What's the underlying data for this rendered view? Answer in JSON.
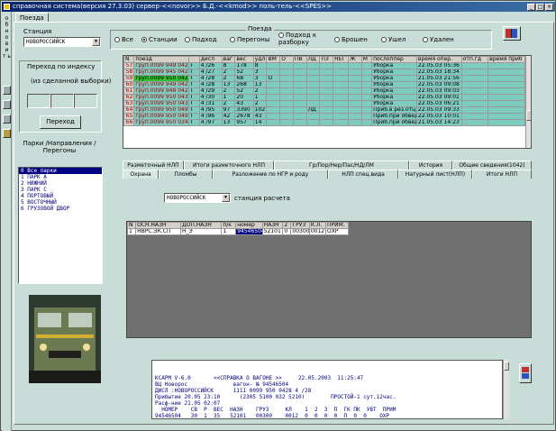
{
  "window": {
    "title": "справочная система(версия 27.3.03) сервер-<<novor>> Б.Д.-<<kmod>> поль-тель-<<SPES>>"
  },
  "left_strip": {
    "text": "о б н о в и т ь"
  },
  "top_tab": {
    "label": "Поезда"
  },
  "station": {
    "label": "Станция",
    "value": "НОВОРОССИЙСК"
  },
  "trains_group": {
    "title": "Поезда",
    "radios": [
      {
        "label": "Все",
        "selected": false
      },
      {
        "label": "Станции",
        "selected": true
      },
      {
        "label": "Подход",
        "selected": false
      },
      {
        "label": "Перегоны",
        "selected": false
      },
      {
        "label": "Подход к разборку",
        "selected": false
      },
      {
        "label": "Брошен",
        "selected": false
      },
      {
        "label": "Ушел",
        "selected": false
      },
      {
        "label": "Удален",
        "selected": false
      }
    ]
  },
  "index_search": {
    "label1": "Переход по индексу",
    "label2": "(из сделанной выборки)",
    "button": "Переход"
  },
  "parks": {
    "label": "Парки /Направления / Перегоны",
    "items": [
      "0 Все парки",
      "1 ПАРК А",
      "2 НИЖНИЙ",
      "3 ПАРК С",
      "4 ПОРТОВЫЙ",
      "5 ВОСТОЧНЫЙ",
      "6 ГРУЗОВОЙ ДВОР"
    ]
  },
  "trains_table": {
    "headers": [
      "N",
      "поезд",
      "",
      "дисл",
      "ваг",
      "вес",
      "удл",
      "ВМ",
      "О",
      "ПВ",
      "ЛД",
      "ПЗ",
      "НЕГ",
      "Ж",
      "М",
      "послоппер",
      "время опер.",
      "отп.гд",
      "время приб"
    ],
    "rows": [
      [
        "57",
        "груп.0099 949 0426",
        "Г",
        "4 /26",
        "8",
        "178",
        "8",
        "",
        "",
        "",
        "",
        "",
        "",
        "",
        "",
        "Уборка",
        "22.05.03 05:36",
        "",
        ""
      ],
      [
        "58",
        "груп.0099 945 0427",
        "Г",
        "4 /27",
        "2",
        "52",
        "3",
        "",
        "",
        "",
        "",
        "",
        "",
        "",
        "",
        "Уборка",
        "22.05.03 18:34",
        "",
        ""
      ],
      [
        "59",
        "груп.0099 950 0428",
        "Г",
        "4 /28",
        "2",
        "68",
        "3",
        "О",
        "",
        "",
        "",
        "",
        "",
        "",
        "",
        "Уборка",
        "21.05.03 21:56",
        "",
        ""
      ],
      [
        "60",
        "груп.0099 949 0429",
        "Г",
        "4 /28",
        "13",
        "268",
        "13",
        "",
        "",
        "",
        "",
        "",
        "",
        "",
        "",
        "Уборка",
        "22.05.03 09:08",
        "",
        ""
      ],
      [
        "61",
        "груп.0099 948 0429",
        "Г",
        "4 /29",
        "2",
        "52",
        "2",
        "",
        "",
        "",
        "",
        "",
        "",
        "",
        "",
        "Уборка",
        "22.05.03 09:03",
        "",
        ""
      ],
      [
        "62",
        "груп.0099 950 0430",
        "Г",
        "4 /30",
        "1",
        "20",
        "1",
        "",
        "",
        "",
        "",
        "",
        "",
        "",
        "",
        "Уборка",
        "22.05.03 09:01",
        "",
        ""
      ],
      [
        "63",
        "груп.0099 950 0431",
        "Г",
        "4 /31",
        "2",
        "43",
        "2",
        "",
        "",
        "",
        "",
        "",
        "",
        "",
        "",
        "Уборка",
        "22.05.03 06:21",
        "",
        ""
      ],
      [
        "64",
        "груп.0099 950 0495",
        "Г",
        "4 /95",
        "97",
        "3390",
        "102",
        "",
        "",
        "",
        "ЛД",
        "",
        "",
        "",
        "",
        "Приб.в рез.отц.",
        "22.05.03 09:33",
        "",
        ""
      ],
      [
        "65",
        "груп.0099 950 0496",
        "Г",
        "4 /96",
        "42",
        "2678",
        "43",
        "",
        "",
        "",
        "",
        "",
        "",
        "",
        "",
        "Приб.при обвед.",
        "22.05.03 10:01",
        "",
        ""
      ],
      [
        "66",
        "груп.0099 950 0344",
        "Г",
        "4 /97",
        "13",
        "957",
        "14",
        "",
        "",
        "",
        "",
        "",
        "",
        "",
        "",
        "Приб.при обвед.",
        "21.05.03 14:23",
        "",
        ""
      ]
    ],
    "selected_row": 2
  },
  "tabs_row1": [
    "Разметочный НЛП",
    "Итоги разметочного НЛП",
    "Гр/Пор/Нер/Пас/НД/ЛМ",
    "История",
    "Общие сведения(1042)"
  ],
  "tabs_row2": [
    "Охрана",
    "Пломбы",
    "Разложение по НГР и роду",
    "НЛП спец.вида",
    "Натурный лист(НЛП)",
    "Итоги НЛП"
  ],
  "calc_station": {
    "value": "НОВОРОССИЙСК",
    "label": "станция расчета"
  },
  "guard_table": {
    "headers": [
      "N",
      "ОСН.НАЗН",
      "ДОП.НАЗН",
      "п/к",
      "номер",
      "НАЗН",
      "2",
      "ГРУЗ",
      "К.Л.",
      "ПРИМ."
    ],
    "rows": [
      [
        "1",
        "НВРС.ЭК.СП",
        "Н_Э",
        "1",
        "94546504",
        "52101",
        "0",
        "00300",
        "0012",
        "ОХР"
      ]
    ]
  },
  "text_pane": {
    "lines": [
      "КСАРМ V-6.0       <<СПРАВКА О ВАГОНЕ >>     22.05.2003  11:25:47",
      "ВЦ Новорос              вагон- № 94546504",
      "ДИСЛ :НОВОРОССИЙСК      1111 0099 950 0428 4 /28",
      "Прибытие 20.05 23:10      (2305 5100 032 5210)        ПРОСТОЙ-1 сут.12час.",
      "Расф-ние 21.05 02:07",
      "  НОМЕР    СВ  Р  ВЕС  НАЗН    ГРУЗ     КЛ    1  2  3  П  ГК ПК  УВТ  ПРИМ",
      "94546504   30  1  35   52101   00300    0012  0  0  0  0  П  0  0    ОХР"
    ]
  }
}
